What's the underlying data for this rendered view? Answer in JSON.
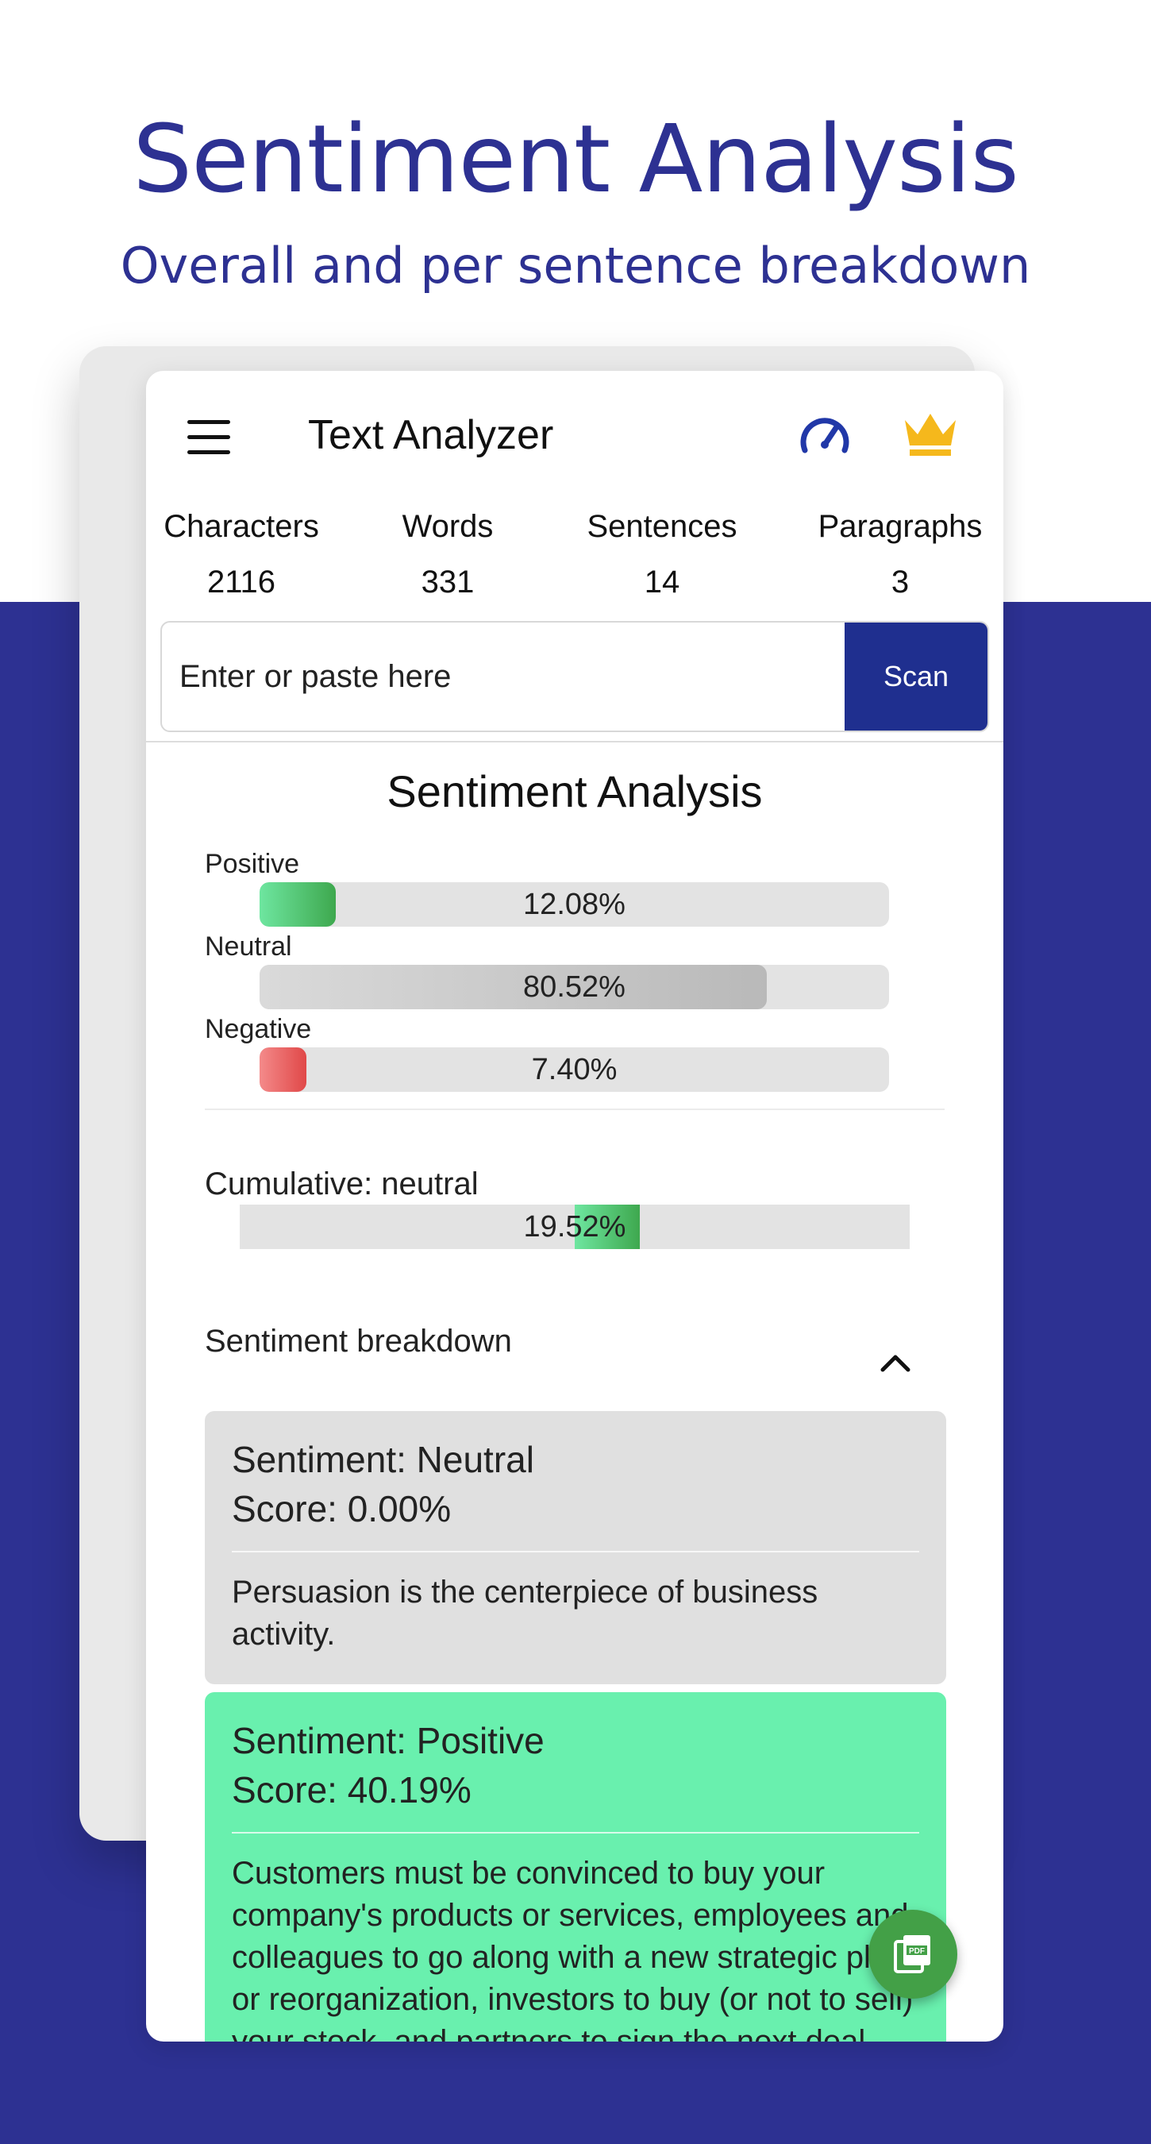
{
  "promo": {
    "title": "Sentiment Analysis",
    "subtitle": "Overall and per sentence breakdown"
  },
  "appbar": {
    "title": "Text Analyzer",
    "icons": [
      "menu-icon",
      "speedometer-icon",
      "crown-icon"
    ]
  },
  "stats": [
    {
      "label": "Characters",
      "value": "2116"
    },
    {
      "label": "Words",
      "value": "331"
    },
    {
      "label": "Sentences",
      "value": "14"
    },
    {
      "label": "Paragraphs",
      "value": "3"
    }
  ],
  "input": {
    "placeholder": "Enter or paste here",
    "value": ""
  },
  "scan_button": "Scan",
  "sentiment": {
    "title": "Sentiment Analysis",
    "bars": [
      {
        "label": "Positive",
        "text": "12.08%",
        "value": 0.1208
      },
      {
        "label": "Neutral",
        "text": "80.52%",
        "value": 0.8052
      },
      {
        "label": "Negative",
        "text": "7.40%",
        "value": 0.074
      }
    ],
    "cumulative": {
      "label": "Cumulative: neutral",
      "text": "19.52%",
      "value": 0.1952
    }
  },
  "breakdown": {
    "label": "Sentiment breakdown",
    "items": [
      {
        "sentiment": "Sentiment: Neutral",
        "score": "Score: 0.00%",
        "text": "Persuasion is the centerpiece of business activity."
      },
      {
        "sentiment": "Sentiment: Positive",
        "score": "Score: 40.19%",
        "text": "Customers must be convinced to buy your company's products or services, employees and colleagues to go along with a new strategic plan or reorganization, investors to buy (or not to sell) your stock, and partners to sign the next deal."
      }
    ]
  },
  "colors": {
    "brand": "#2d3192",
    "scan_button": "#1f2f8f",
    "positive": "#69f0ae",
    "neutral": "#e0e0e0",
    "negative": "#e04848",
    "crown": "#f5b81c",
    "fab": "#43a047"
  },
  "fab_icon": "pdf-icon"
}
